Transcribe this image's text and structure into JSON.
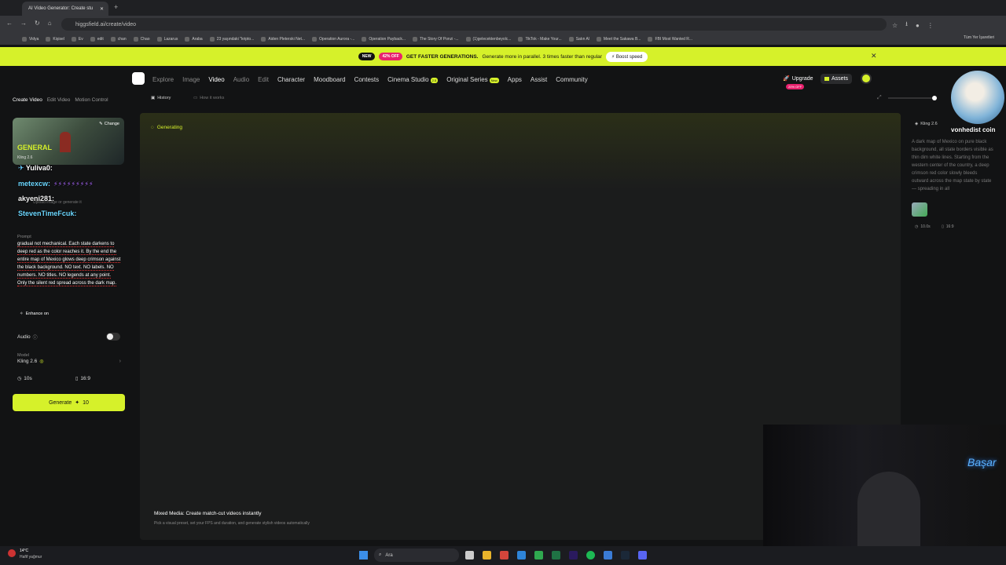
{
  "browser": {
    "tab_title": "AI Video Generator: Create stu",
    "url": "higgsfield.ai/create/video",
    "bookmarks": [
      "Vidya",
      "Kişisel",
      "Ev",
      "edit",
      "chan",
      "Chao",
      "Lazarus",
      "Araba",
      "23 yaşındaki \"kripto...",
      "Aiden Pleterski Net...",
      "Operation Aurora -...",
      "Operation Payback...",
      "The Story Of Ponzi -...",
      "(1)gelecektenbeyolc...",
      "TikTok - Make Your...",
      "Satın Al",
      "Meet the Sakawa B...",
      "FBI Most Wanted R..."
    ],
    "bookmarks_all": "Tüm Yer İşaretleri"
  },
  "banner": {
    "new": "NEW",
    "discount": "42% OFF",
    "headline": "GET FASTER GENERATIONS.",
    "text": "Generate more in parallel. 3 times faster than regular",
    "boost": "Boost speed"
  },
  "nav": {
    "items": [
      "Explore",
      "Image",
      "Video",
      "Audio",
      "Edit",
      "Character",
      "Moodboard",
      "Contests",
      "Cinema Studio",
      "Original Series",
      "Apps",
      "Assist",
      "Community"
    ],
    "cinema_tag": "2.5",
    "series_tag": "New",
    "upgrade": "Upgrade",
    "upgrade_badge": "20% OFF",
    "assets": "Assets"
  },
  "left": {
    "tabs": [
      "Create Video",
      "Edit Video",
      "Motion Control"
    ],
    "card_title": "GENERAL",
    "card_sub": "Kling 2.6",
    "change": "Change",
    "upload": "Upload image or generate it",
    "prompt_label": "Prompt",
    "prompt": "gradual not mechanical. Each state darkens to deep red as the color reaches it. By the end the entire map of Mexico glows deep crimson against the black background. NO text. NO labels. NO numbers. NO titles. NO legends at any point. Only the silent red spread across the dark map.",
    "enhance": "Enhance on",
    "audio": "Audio",
    "model_label": "Model",
    "model": "Kling 2.6",
    "duration": "10s",
    "ratio": "16:9",
    "generate": "Generate",
    "cost": "10"
  },
  "chat": [
    {
      "user": "Yuliva0:"
    },
    {
      "user": "metexcw:"
    },
    {
      "user": "akyeni281:"
    },
    {
      "user": "StevenTimeFcuk:"
    }
  ],
  "main": {
    "history": "History",
    "how": "How it works",
    "status": "Generating",
    "footer_title": "Mixed Media: Create match-cut videos instantly",
    "footer_text": "Pick a visual preset, set your FPS and duration, and generate stylish videos automatically"
  },
  "right": {
    "model": "Kling 2.6",
    "desc": "A dark map of Mexico on pure black background, all state borders visible as thin dim white lines. Starting from the western center of the country, a deep crimson red color slowly bleeds outward across the map state by state — spreading in all",
    "duration": "10.0s",
    "ratio": "16:9"
  },
  "overlay": {
    "streamer": "vonhedist coin",
    "neon": "Başar"
  },
  "taskbar": {
    "temp": "14°C",
    "weather": "Hafif yağmur",
    "search": "Ara"
  }
}
